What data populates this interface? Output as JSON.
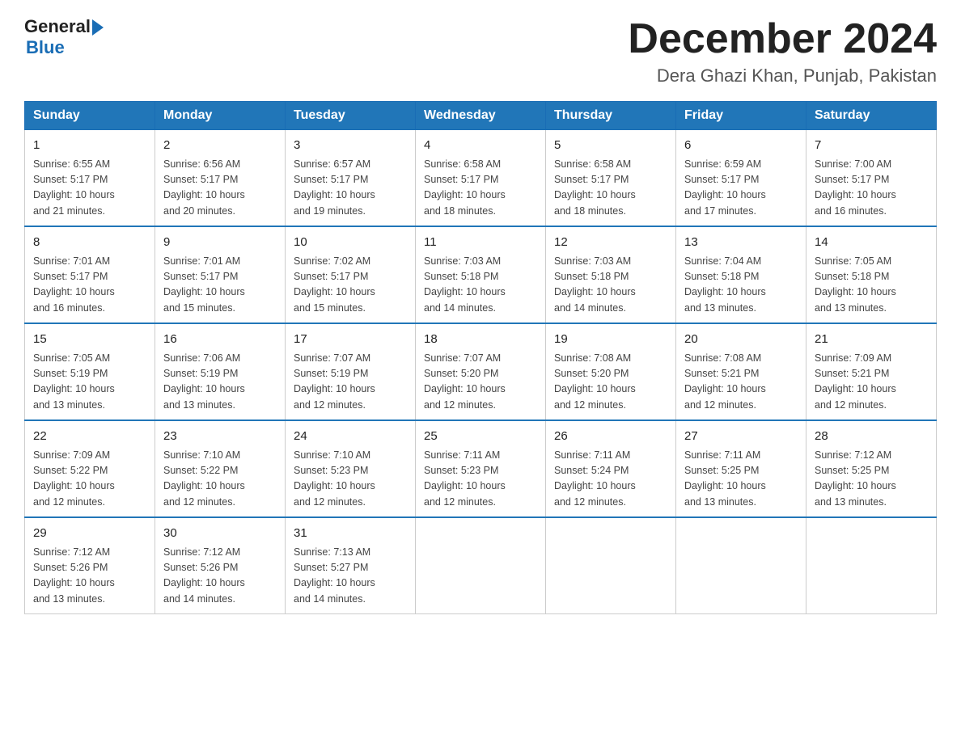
{
  "header": {
    "logo_line1": "General",
    "logo_line2": "Blue",
    "title": "December 2024",
    "subtitle": "Dera Ghazi Khan, Punjab, Pakistan"
  },
  "days_of_week": [
    "Sunday",
    "Monday",
    "Tuesday",
    "Wednesday",
    "Thursday",
    "Friday",
    "Saturday"
  ],
  "weeks": [
    [
      {
        "day": "1",
        "sunrise": "6:55 AM",
        "sunset": "5:17 PM",
        "daylight": "10 hours and 21 minutes."
      },
      {
        "day": "2",
        "sunrise": "6:56 AM",
        "sunset": "5:17 PM",
        "daylight": "10 hours and 20 minutes."
      },
      {
        "day": "3",
        "sunrise": "6:57 AM",
        "sunset": "5:17 PM",
        "daylight": "10 hours and 19 minutes."
      },
      {
        "day": "4",
        "sunrise": "6:58 AM",
        "sunset": "5:17 PM",
        "daylight": "10 hours and 18 minutes."
      },
      {
        "day": "5",
        "sunrise": "6:58 AM",
        "sunset": "5:17 PM",
        "daylight": "10 hours and 18 minutes."
      },
      {
        "day": "6",
        "sunrise": "6:59 AM",
        "sunset": "5:17 PM",
        "daylight": "10 hours and 17 minutes."
      },
      {
        "day": "7",
        "sunrise": "7:00 AM",
        "sunset": "5:17 PM",
        "daylight": "10 hours and 16 minutes."
      }
    ],
    [
      {
        "day": "8",
        "sunrise": "7:01 AM",
        "sunset": "5:17 PM",
        "daylight": "10 hours and 16 minutes."
      },
      {
        "day": "9",
        "sunrise": "7:01 AM",
        "sunset": "5:17 PM",
        "daylight": "10 hours and 15 minutes."
      },
      {
        "day": "10",
        "sunrise": "7:02 AM",
        "sunset": "5:17 PM",
        "daylight": "10 hours and 15 minutes."
      },
      {
        "day": "11",
        "sunrise": "7:03 AM",
        "sunset": "5:18 PM",
        "daylight": "10 hours and 14 minutes."
      },
      {
        "day": "12",
        "sunrise": "7:03 AM",
        "sunset": "5:18 PM",
        "daylight": "10 hours and 14 minutes."
      },
      {
        "day": "13",
        "sunrise": "7:04 AM",
        "sunset": "5:18 PM",
        "daylight": "10 hours and 13 minutes."
      },
      {
        "day": "14",
        "sunrise": "7:05 AM",
        "sunset": "5:18 PM",
        "daylight": "10 hours and 13 minutes."
      }
    ],
    [
      {
        "day": "15",
        "sunrise": "7:05 AM",
        "sunset": "5:19 PM",
        "daylight": "10 hours and 13 minutes."
      },
      {
        "day": "16",
        "sunrise": "7:06 AM",
        "sunset": "5:19 PM",
        "daylight": "10 hours and 13 minutes."
      },
      {
        "day": "17",
        "sunrise": "7:07 AM",
        "sunset": "5:19 PM",
        "daylight": "10 hours and 12 minutes."
      },
      {
        "day": "18",
        "sunrise": "7:07 AM",
        "sunset": "5:20 PM",
        "daylight": "10 hours and 12 minutes."
      },
      {
        "day": "19",
        "sunrise": "7:08 AM",
        "sunset": "5:20 PM",
        "daylight": "10 hours and 12 minutes."
      },
      {
        "day": "20",
        "sunrise": "7:08 AM",
        "sunset": "5:21 PM",
        "daylight": "10 hours and 12 minutes."
      },
      {
        "day": "21",
        "sunrise": "7:09 AM",
        "sunset": "5:21 PM",
        "daylight": "10 hours and 12 minutes."
      }
    ],
    [
      {
        "day": "22",
        "sunrise": "7:09 AM",
        "sunset": "5:22 PM",
        "daylight": "10 hours and 12 minutes."
      },
      {
        "day": "23",
        "sunrise": "7:10 AM",
        "sunset": "5:22 PM",
        "daylight": "10 hours and 12 minutes."
      },
      {
        "day": "24",
        "sunrise": "7:10 AM",
        "sunset": "5:23 PM",
        "daylight": "10 hours and 12 minutes."
      },
      {
        "day": "25",
        "sunrise": "7:11 AM",
        "sunset": "5:23 PM",
        "daylight": "10 hours and 12 minutes."
      },
      {
        "day": "26",
        "sunrise": "7:11 AM",
        "sunset": "5:24 PM",
        "daylight": "10 hours and 12 minutes."
      },
      {
        "day": "27",
        "sunrise": "7:11 AM",
        "sunset": "5:25 PM",
        "daylight": "10 hours and 13 minutes."
      },
      {
        "day": "28",
        "sunrise": "7:12 AM",
        "sunset": "5:25 PM",
        "daylight": "10 hours and 13 minutes."
      }
    ],
    [
      {
        "day": "29",
        "sunrise": "7:12 AM",
        "sunset": "5:26 PM",
        "daylight": "10 hours and 13 minutes."
      },
      {
        "day": "30",
        "sunrise": "7:12 AM",
        "sunset": "5:26 PM",
        "daylight": "10 hours and 14 minutes."
      },
      {
        "day": "31",
        "sunrise": "7:13 AM",
        "sunset": "5:27 PM",
        "daylight": "10 hours and 14 minutes."
      },
      null,
      null,
      null,
      null
    ]
  ],
  "labels": {
    "sunrise": "Sunrise:",
    "sunset": "Sunset:",
    "daylight": "Daylight:"
  }
}
